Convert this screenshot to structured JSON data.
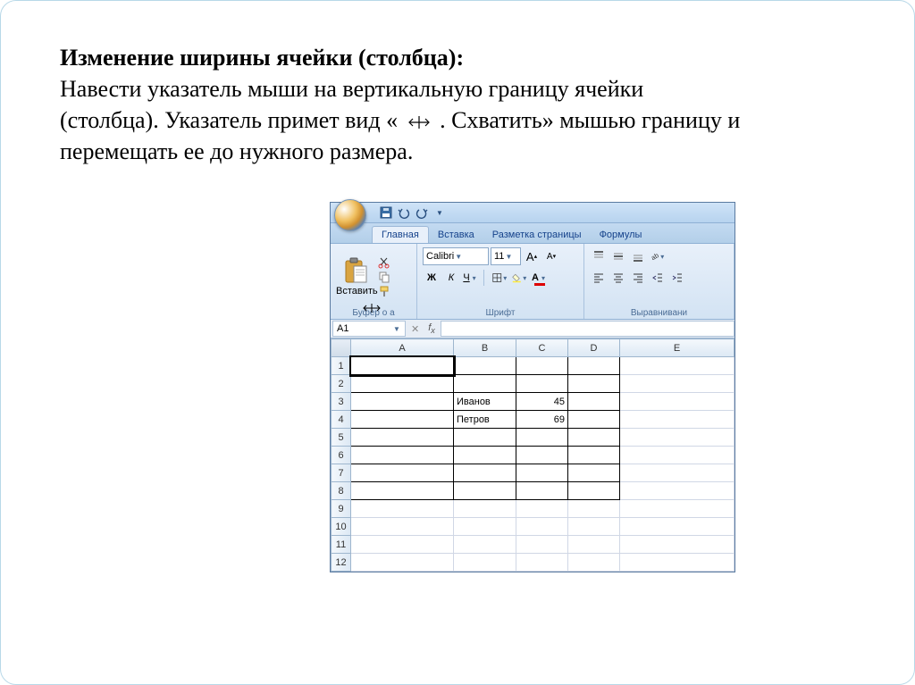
{
  "text": {
    "heading": "Изменение ширины ячейки (столбца):",
    "p1": "Навести указатель мыши на вертикальную границу ячейки (столбца). Указатель примет вид   «",
    "p2": ". Схватить» мышью границу и перемещать ее до нужного размера."
  },
  "excel": {
    "tabs": [
      "Главная",
      "Вставка",
      "Разметка страницы",
      "Формулы"
    ],
    "active_tab": "Главная",
    "paste_label": "Вставить",
    "group_clipboard": "Буфер о",
    "group_clipboard2": "а",
    "group_font": "Шрифт",
    "group_align": "Выравнивани",
    "font_name": "Calibri",
    "font_size": "11",
    "bold": "Ж",
    "italic": "К",
    "underline": "Ч",
    "grow_font": "A",
    "shrink_font": "A",
    "namebox": "A1",
    "columns": [
      "A",
      "B",
      "C",
      "D",
      "E"
    ],
    "rows": [
      "1",
      "2",
      "3",
      "4",
      "5",
      "6",
      "7",
      "8",
      "9",
      "10",
      "11",
      "12"
    ],
    "cells": {
      "B3": "Иванов",
      "C3": "45",
      "B4": "Петров",
      "C4": "69"
    }
  }
}
